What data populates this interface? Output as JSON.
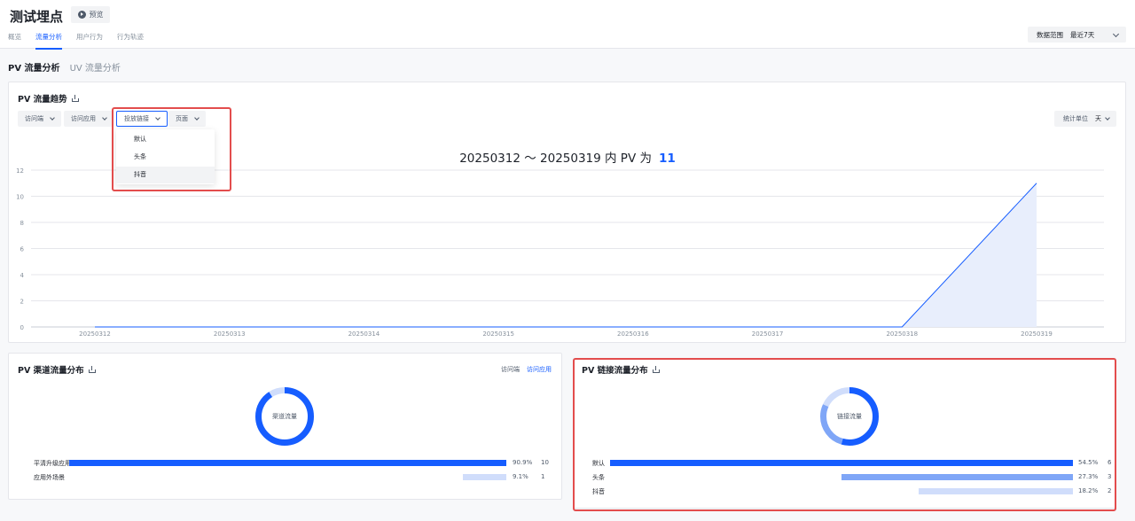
{
  "header": {
    "app_title": "测试埋点",
    "preview_label": "预览",
    "nav_tabs": [
      {
        "label": "概览",
        "active": false
      },
      {
        "label": "流量分析",
        "active": true
      },
      {
        "label": "用户行为",
        "active": false
      },
      {
        "label": "行为轨迹",
        "active": false
      }
    ],
    "date_range_label": "数据范围",
    "date_range_value": "最近7天"
  },
  "subtabs": [
    {
      "label": "PV 流量分析",
      "active": true
    },
    {
      "label": "UV 流量分析",
      "active": false
    }
  ],
  "trend_card": {
    "title": "PV 流量趋势",
    "filters": [
      "访问端",
      "访问应用",
      "投放链接",
      "页面"
    ],
    "active_filter": "投放链接",
    "dropdown_options": [
      "默认",
      "头条",
      "抖音"
    ],
    "dropdown_hover": "抖音",
    "unit_label": "统计单位",
    "unit_value": "天",
    "headline_range": "20250312 ～ 20250319 内 PV 为",
    "headline_count": "11"
  },
  "chart_data": {
    "type": "area",
    "x": [
      "20250312",
      "20250313",
      "20250314",
      "20250315",
      "20250316",
      "20250317",
      "20250318",
      "20250319"
    ],
    "series": [
      {
        "values": [
          0,
          0,
          0,
          0,
          0,
          0,
          0,
          11
        ]
      }
    ],
    "ylim": [
      0,
      12
    ],
    "yticks": [
      0,
      2,
      4,
      6,
      8,
      10,
      12
    ],
    "grid": true,
    "colors": {
      "line": "#165dff",
      "fill": "#e8eefc"
    }
  },
  "channel_card": {
    "title": "PV 渠道流量分布",
    "toggle": [
      {
        "label": "访问端",
        "active": false
      },
      {
        "label": "访问应用",
        "active": true
      }
    ],
    "donut_label": "渠道流量",
    "rows": [
      {
        "label": "平清升级应用",
        "percent": "90.9%",
        "count": "10",
        "fraction": 0.909,
        "color": "#165dff"
      },
      {
        "label": "应用外场景",
        "percent": "9.1%",
        "count": "1",
        "fraction": 0.091,
        "color": "#d0ddfb"
      }
    ]
  },
  "link_card": {
    "title": "PV 链接流量分布",
    "donut_label": "链接流量",
    "rows": [
      {
        "label": "默认",
        "percent": "54.5%",
        "count": "6",
        "fraction": 0.545,
        "color": "#165dff"
      },
      {
        "label": "头条",
        "percent": "27.3%",
        "count": "3",
        "fraction": 0.273,
        "color": "#7fa6f7"
      },
      {
        "label": "抖音",
        "percent": "18.2%",
        "count": "2",
        "fraction": 0.182,
        "color": "#d0ddfb"
      }
    ]
  }
}
